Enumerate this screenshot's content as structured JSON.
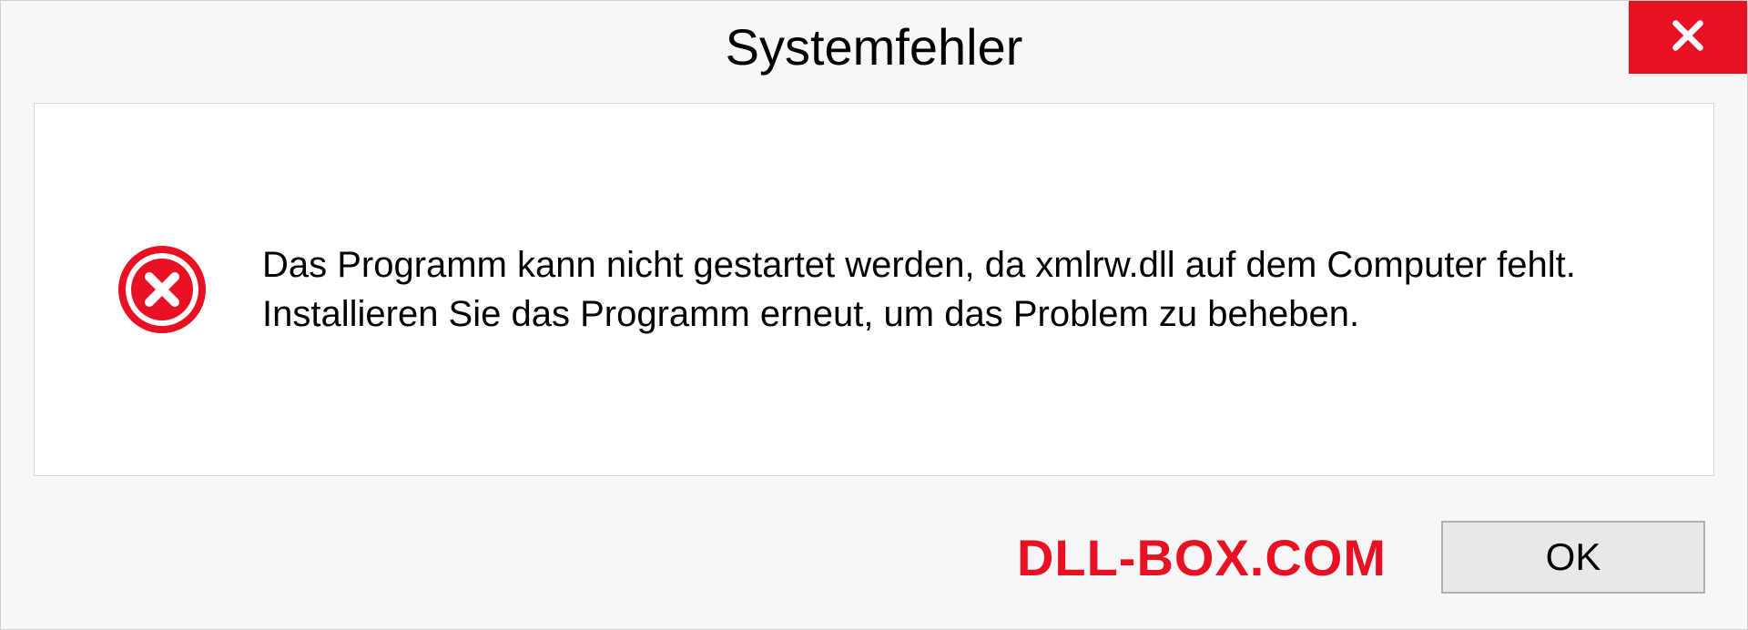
{
  "dialog": {
    "title": "Systemfehler",
    "message": "Das Programm kann nicht gestartet werden, da xmlrw.dll auf dem Computer fehlt. Installieren Sie das Programm erneut, um das Problem zu beheben.",
    "ok_label": "OK"
  },
  "watermark": "DLL-BOX.COM"
}
